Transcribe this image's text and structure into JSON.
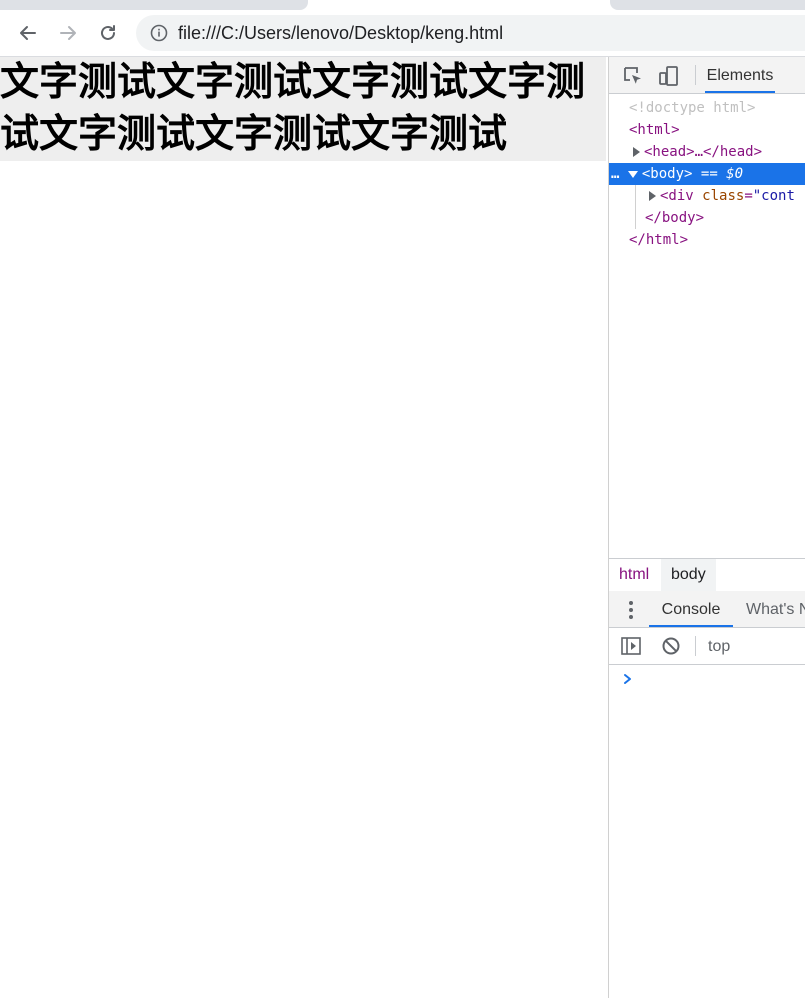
{
  "browser": {
    "url": "file:///C:/Users/lenovo/Desktop/keng.html"
  },
  "page": {
    "text": "文字测试文字测试文字测试文字测试文字测试文字测试文字测试"
  },
  "devtools": {
    "main_tab": "Elements",
    "tree": {
      "doctype": "<!doctype html>",
      "html_open": "<html>",
      "head": "<head>…</head>",
      "body_open": "<body>",
      "body_marker": "== $0",
      "ellipsis": "…",
      "div_open": "<div",
      "div_attr_name": "class",
      "div_attr_val": "\"cont",
      "body_close": "</body>",
      "html_close": "</html>"
    },
    "breadcrumbs": [
      "html",
      "body"
    ],
    "drawer_tabs": [
      "Console",
      "What's N"
    ],
    "console_context": "top"
  },
  "colors": {
    "accent": "#1a73e8",
    "content_bg": "#eeeeee",
    "tag": "#881280"
  }
}
